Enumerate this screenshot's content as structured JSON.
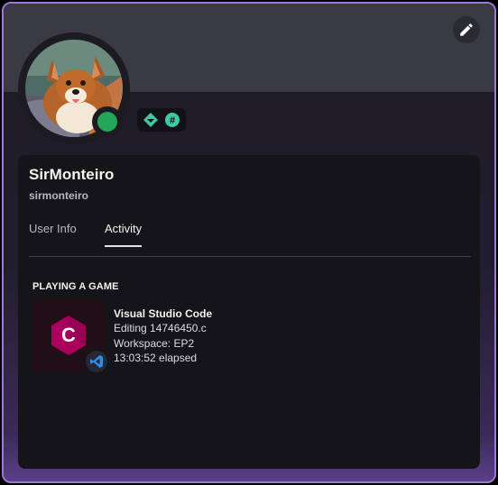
{
  "profile": {
    "display_name": "SirMonteiro",
    "username": "sirmonteiro",
    "status": "online",
    "avatar_description": "avatar-dog-image",
    "badges": [
      "hypesquad-icon",
      "hashtag-icon"
    ]
  },
  "header": {
    "edit_icon": "pencil-icon"
  },
  "tabs": [
    {
      "label": "User Info",
      "active": false
    },
    {
      "label": "Activity",
      "active": true
    }
  ],
  "activity": {
    "section_title": "PLAYING A GAME",
    "app_name": "Visual Studio Code",
    "details": "Editing 14746450.c",
    "state": "Workspace: EP2",
    "elapsed": "13:03:52 elapsed",
    "large_icon": "c-language-icon",
    "small_icon": "vscode-icon"
  },
  "colors": {
    "accent_border": "#9e78d2",
    "status_online": "#23a55a",
    "c_logo": "#a8005c"
  }
}
